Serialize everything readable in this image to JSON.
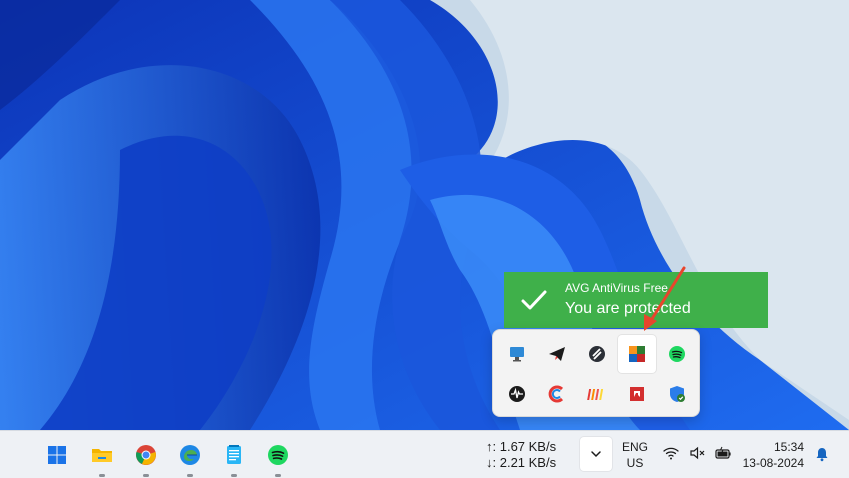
{
  "toast": {
    "app_name": "AVG AntiVirus Free",
    "message": "You are protected",
    "color": "#3fb04a"
  },
  "tray_overflow": {
    "icons": [
      {
        "name": "monitor-icon"
      },
      {
        "name": "telegram-icon"
      },
      {
        "name": "app-logo-icon"
      },
      {
        "name": "avg-icon",
        "selected": true
      },
      {
        "name": "spotify-icon"
      },
      {
        "name": "audio-app-icon"
      },
      {
        "name": "ccleaner-icon"
      },
      {
        "name": "bars-app-icon"
      },
      {
        "name": "amd-icon"
      },
      {
        "name": "windows-security-icon"
      }
    ]
  },
  "taskbar": {
    "apps": [
      {
        "name": "start-button"
      },
      {
        "name": "file-explorer-app"
      },
      {
        "name": "chrome-app"
      },
      {
        "name": "edge-app"
      },
      {
        "name": "notepad-app"
      },
      {
        "name": "spotify-app"
      }
    ],
    "net_up": "↑: 1.67 KB/s",
    "net_down": "↓: 2.21 KB/s",
    "lang_line1": "ENG",
    "lang_line2": "US",
    "time": "15:34",
    "date": "13-08-2024"
  }
}
